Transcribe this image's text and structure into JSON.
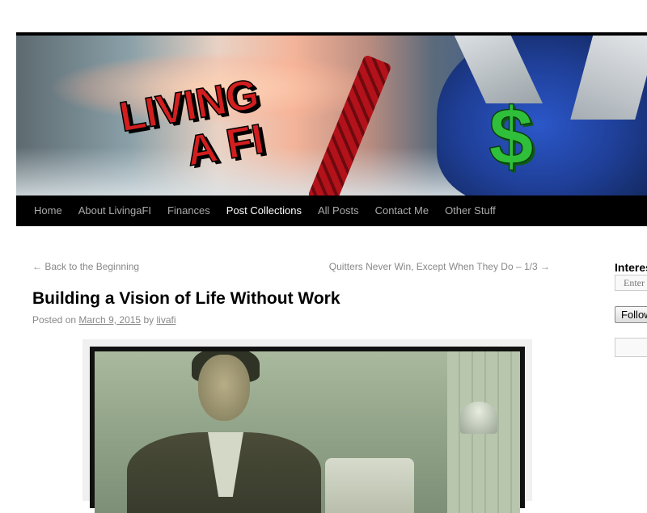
{
  "header": {
    "logo_line1": "LIVING",
    "logo_line2": "A FI",
    "dollar_symbol": "$"
  },
  "nav": {
    "items": [
      {
        "label": "Home"
      },
      {
        "label": "About LivingaFI"
      },
      {
        "label": "Finances"
      },
      {
        "label": "Post Collections",
        "current": true
      },
      {
        "label": "All Posts"
      },
      {
        "label": "Contact Me"
      },
      {
        "label": "Other Stuff"
      }
    ]
  },
  "post": {
    "prev_link": "← Back to the Beginning",
    "next_link": "Quitters Never Win, Except When They Do – 1/3 →",
    "title": "Building a Vision of Life Without Work",
    "meta_posted_on": "Posted on",
    "date": "March 9, 2015",
    "meta_by": "by",
    "author": "livafi"
  },
  "sidebar": {
    "widget_title": "Interested",
    "email_placeholder": "Enter your",
    "follow_label": "Follow"
  },
  "colors": {
    "nav_bg": "#000000",
    "nav_text": "#aaaaaa",
    "nav_current": "#ffffff",
    "logo_red": "#d21e1e",
    "dollar_green": "#2fbf3a"
  }
}
